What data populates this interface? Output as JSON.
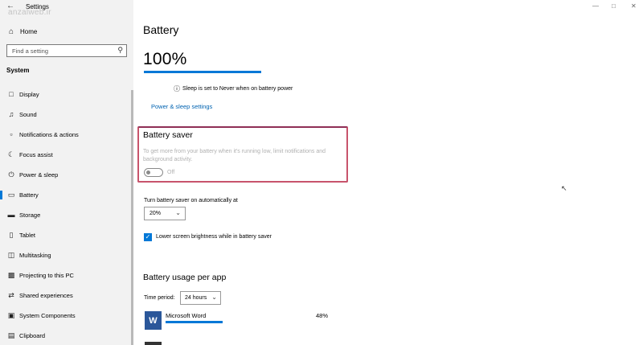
{
  "window": {
    "back_icon": "back-arrow-icon",
    "title": "Settings",
    "watermark": "anzalweb.ir"
  },
  "sidebar": {
    "home": {
      "label": "Home",
      "icon": "home-icon"
    },
    "search": {
      "placeholder": "Find a setting",
      "icon": "search-icon"
    },
    "section": "System",
    "items": [
      {
        "label": "Display",
        "icon": "display-icon"
      },
      {
        "label": "Sound",
        "icon": "sound-icon"
      },
      {
        "label": "Notifications & actions",
        "icon": "notifications-icon"
      },
      {
        "label": "Focus assist",
        "icon": "focus-assist-icon"
      },
      {
        "label": "Power & sleep",
        "icon": "power-icon"
      },
      {
        "label": "Battery",
        "icon": "battery-icon",
        "active": true
      },
      {
        "label": "Storage",
        "icon": "storage-icon"
      },
      {
        "label": "Tablet",
        "icon": "tablet-icon"
      },
      {
        "label": "Multitasking",
        "icon": "multitasking-icon"
      },
      {
        "label": "Projecting to this PC",
        "icon": "projecting-icon"
      },
      {
        "label": "Shared experiences",
        "icon": "shared-experiences-icon"
      },
      {
        "label": "System Components",
        "icon": "system-components-icon"
      },
      {
        "label": "Clipboard",
        "icon": "clipboard-icon"
      }
    ]
  },
  "main": {
    "title": "Battery",
    "percent_text": "100%",
    "percent_value": 100,
    "sleep_notice": "Sleep is set to Never when on battery power",
    "power_link": "Power & sleep settings",
    "battery_saver": {
      "title": "Battery saver",
      "description": "To get more from your battery when it's running low, limit notifications and background activity.",
      "toggle_state": "Off"
    },
    "auto_saver": {
      "label": "Turn battery saver on automatically at",
      "value": "20%"
    },
    "lower_brightness": {
      "label": "Lower screen brightness while in battery saver",
      "checked": true
    },
    "usage": {
      "title": "Battery usage per app",
      "time_period_label": "Time period:",
      "time_period_value": "24 hours",
      "apps": [
        {
          "name": "Microsoft Word",
          "percent": "48%",
          "icon_letter": "W",
          "usage_value": 48
        }
      ]
    }
  },
  "colors": {
    "accent": "#0078d7",
    "link": "#0063b1",
    "highlight_border": "#c8546c",
    "sidebar_bg": "#f2f2f2",
    "word_blue": "#2b579a"
  }
}
